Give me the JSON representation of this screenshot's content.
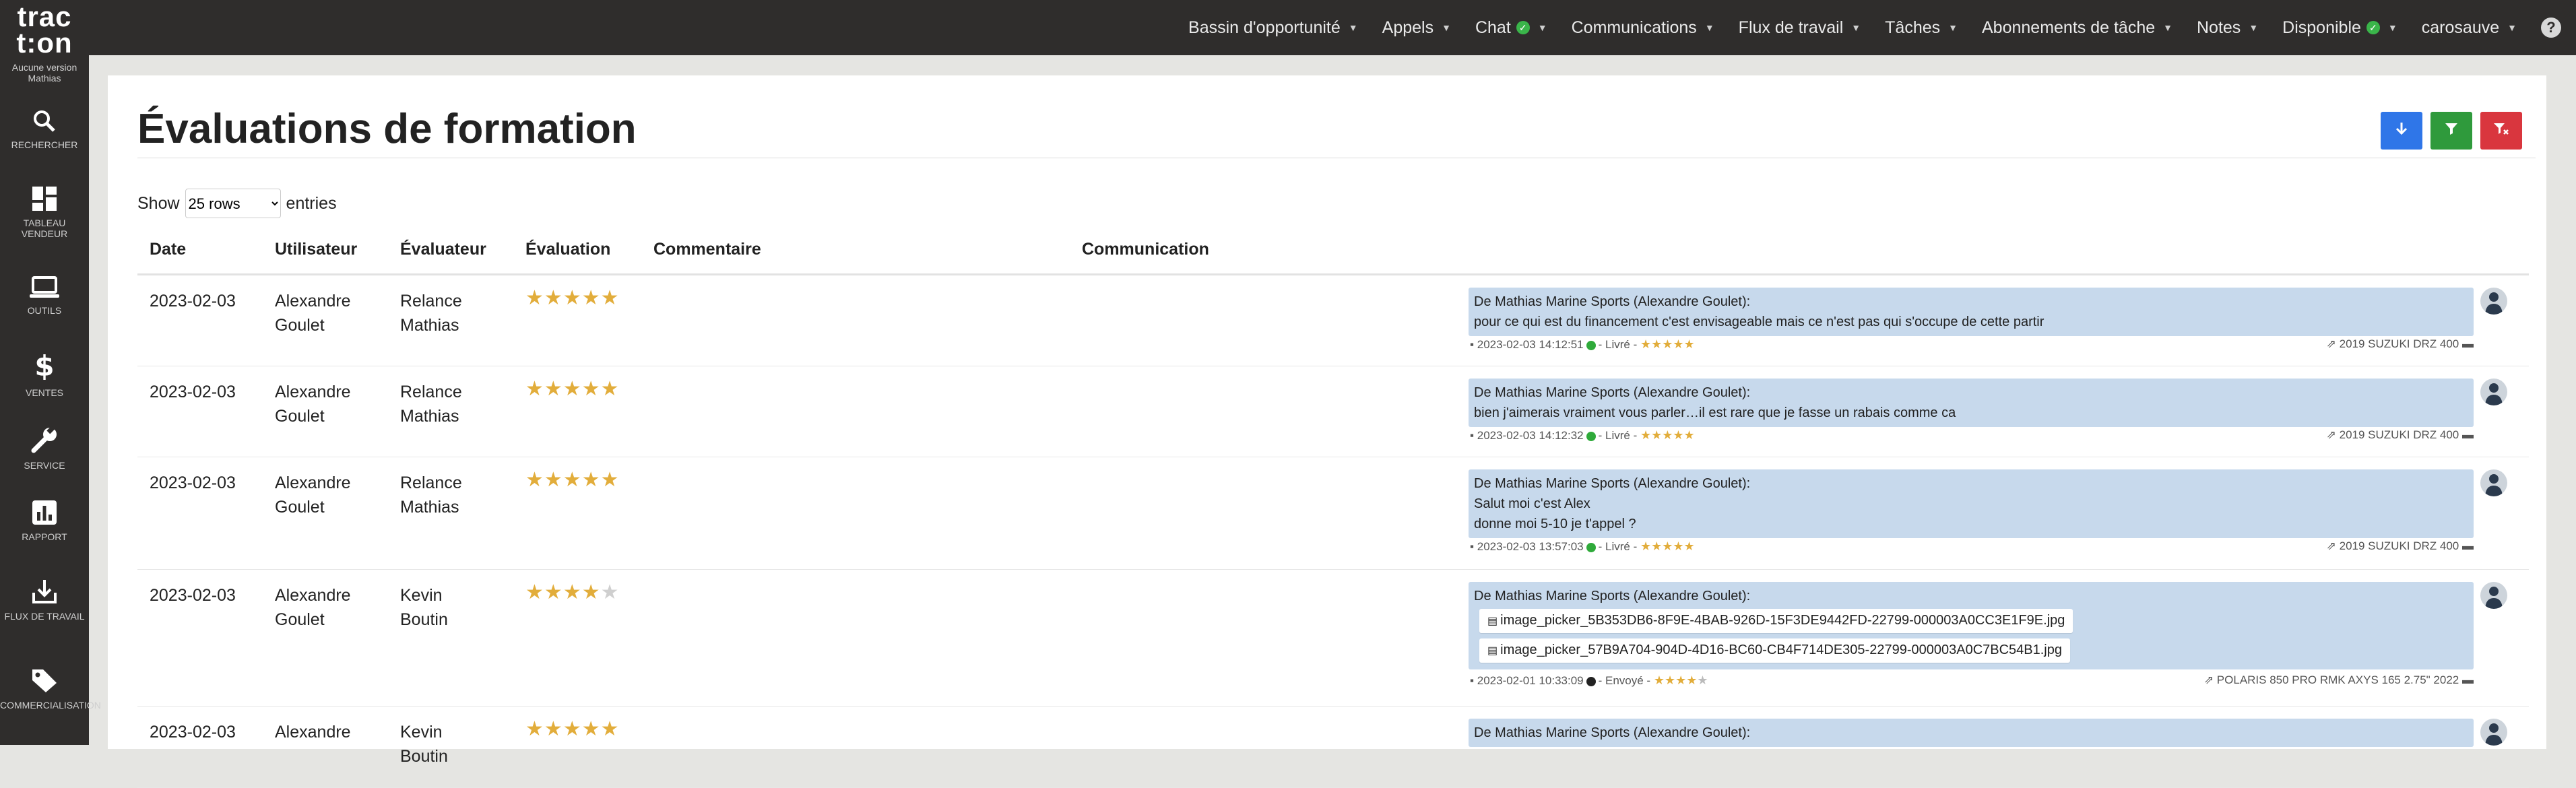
{
  "brand": {
    "line1": "trac",
    "line2": "t:on",
    "version": "Aucune version",
    "user": "Mathias"
  },
  "topnav": [
    {
      "label": "Bassin d'opportunité",
      "check": false
    },
    {
      "label": "Appels",
      "check": false
    },
    {
      "label": "Chat",
      "check": true
    },
    {
      "label": "Communications",
      "check": false
    },
    {
      "label": "Flux de travail",
      "check": false
    },
    {
      "label": "Tâches",
      "check": false
    },
    {
      "label": "Abonnements de tâche",
      "check": false
    },
    {
      "label": "Notes",
      "check": false
    },
    {
      "label": "Disponible",
      "check": true
    },
    {
      "label": "carosauve",
      "check": false
    }
  ],
  "sidebar": [
    {
      "label": "Rechercher",
      "icon": "search-icon"
    },
    {
      "label": "Tableau vendeur",
      "icon": "dashboard-icon"
    },
    {
      "label": "Outils",
      "icon": "laptop-icon"
    },
    {
      "label": "Ventes",
      "icon": "dollar-icon"
    },
    {
      "label": "Service",
      "icon": "wrench-icon"
    },
    {
      "label": "Rapport",
      "icon": "chart-icon"
    },
    {
      "label": "Flux de travail",
      "icon": "download-icon"
    },
    {
      "label": "Commercialisation",
      "icon": "tag-icon"
    }
  ],
  "page": {
    "title": "Évaluations de formation"
  },
  "toolbar": {
    "download_color": "#2f76e8",
    "filter_color": "#2f9a3c",
    "clear_filter_color": "#d9363e"
  },
  "length": {
    "show": "Show",
    "value": "25 rows",
    "entries": "entries"
  },
  "columns": [
    "Date",
    "Utilisateur",
    "Évaluateur",
    "Évaluation",
    "Commentaire",
    "Communication"
  ],
  "rows": [
    {
      "date": "2023-02-03",
      "user": "Alexandre Goulet",
      "evaluator": "Relance Mathias",
      "rating": 5,
      "from": "De Mathias Marine Sports (Alexandre Goulet):",
      "lines": [
        "pour ce qui est du financement c'est envisageable mais ce n'est pas qui s'occupe de cette partir"
      ],
      "attachments": [],
      "timestamp": "2023-02-03 14:12:51",
      "status": "Livré",
      "status_color": "#2faa3a",
      "msg_rating": 5,
      "vehicle": "2019 SUZUKI DRZ 400"
    },
    {
      "date": "2023-02-03",
      "user": "Alexandre Goulet",
      "evaluator": "Relance Mathias",
      "rating": 5,
      "from": "De Mathias Marine Sports (Alexandre Goulet):",
      "lines": [
        "bien j'aimerais vraiment vous parler…il est rare que je fasse un rabais comme ca"
      ],
      "attachments": [],
      "timestamp": "2023-02-03 14:12:32",
      "status": "Livré",
      "status_color": "#2faa3a",
      "msg_rating": 5,
      "vehicle": "2019 SUZUKI DRZ 400"
    },
    {
      "date": "2023-02-03",
      "user": "Alexandre Goulet",
      "evaluator": "Relance Mathias",
      "rating": 5,
      "from": "De Mathias Marine Sports (Alexandre Goulet):",
      "lines": [
        "Salut moi c'est Alex",
        "donne moi 5-10 je t'appel ?"
      ],
      "attachments": [],
      "timestamp": "2023-02-03 13:57:03",
      "status": "Livré",
      "status_color": "#2faa3a",
      "msg_rating": 5,
      "vehicle": "2019 SUZUKI DRZ 400"
    },
    {
      "date": "2023-02-03",
      "user": "Alexandre Goulet",
      "evaluator": "Kevin Boutin",
      "rating": 4,
      "from": "De Mathias Marine Sports (Alexandre Goulet):",
      "lines": [],
      "attachments": [
        "image_picker_5B353DB6-8F9E-4BAB-926D-15F3DE9442FD-22799-000003A0CC3E1F9E.jpg",
        "image_picker_57B9A704-904D-4D16-BC60-CB4F714DE305-22799-000003A0C7BC54B1.jpg"
      ],
      "timestamp": "2023-02-01 10:33:09",
      "status": "Envoyé",
      "status_color": "#222222",
      "msg_rating": 4,
      "vehicle": "POLARIS 850 PRO RMK AXYS 165 2.75\" 2022"
    },
    {
      "date": "2023-02-03",
      "user": "Alexandre",
      "evaluator": "Kevin Boutin",
      "rating": 5,
      "from": "De Mathias Marine Sports (Alexandre Goulet):",
      "lines": [],
      "attachments": [],
      "timestamp": "",
      "status": "",
      "status_color": "#2faa3a",
      "msg_rating": 0,
      "vehicle": ""
    }
  ]
}
